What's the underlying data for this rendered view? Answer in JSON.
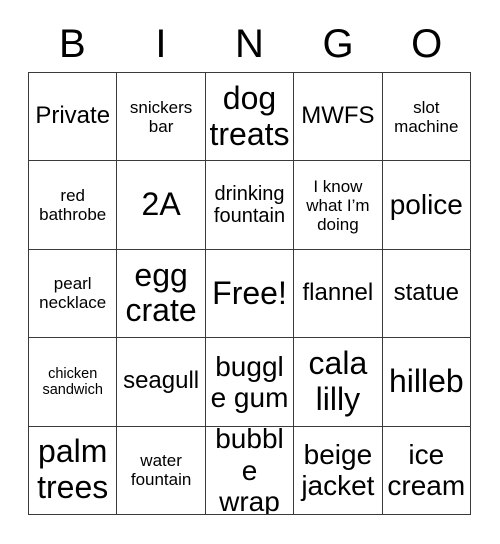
{
  "card": {
    "header_letters": [
      "B",
      "I",
      "N",
      "G",
      "O"
    ],
    "rows": [
      [
        {
          "text": "Private",
          "size": "l"
        },
        {
          "text": "snickers bar",
          "size": "s"
        },
        {
          "text": "dog treats",
          "size": "xxl"
        },
        {
          "text": "MWFS",
          "size": "l"
        },
        {
          "text": "slot machine",
          "size": "s"
        }
      ],
      [
        {
          "text": "red bathrobe",
          "size": "s"
        },
        {
          "text": "2A",
          "size": "xxl"
        },
        {
          "text": "drinking fountain",
          "size": "m"
        },
        {
          "text": "I know what I’m doing",
          "size": "s"
        },
        {
          "text": "police",
          "size": "xl"
        }
      ],
      [
        {
          "text": "pearl necklace",
          "size": "s"
        },
        {
          "text": "egg crate",
          "size": "xxl"
        },
        {
          "text": "Free!",
          "size": "xxl"
        },
        {
          "text": "flannel",
          "size": "l"
        },
        {
          "text": "statue",
          "size": "l"
        }
      ],
      [
        {
          "text": "chicken sandwich",
          "size": "xs"
        },
        {
          "text": "seagull",
          "size": "l"
        },
        {
          "text": "buggle gum",
          "size": "xl"
        },
        {
          "text": "cala lilly",
          "size": "xxl"
        },
        {
          "text": "hilleb",
          "size": "xxl"
        }
      ],
      [
        {
          "text": "palm trees",
          "size": "xxl"
        },
        {
          "text": "water fountain",
          "size": "s"
        },
        {
          "text": "bubble wrap",
          "size": "xl"
        },
        {
          "text": "beige jacket",
          "size": "xl"
        },
        {
          "text": "ice cream",
          "size": "xl"
        }
      ]
    ],
    "colors": {
      "background": "#ffffff",
      "text": "#000000",
      "grid_line": "#3a3a3a"
    }
  }
}
